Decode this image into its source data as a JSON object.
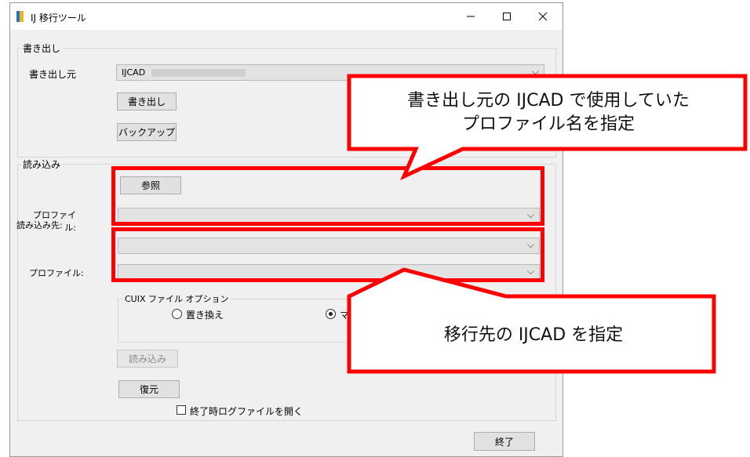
{
  "window": {
    "title": "IJ 移行ツール",
    "minimize": "—",
    "maximize": "☐",
    "close": "✕"
  },
  "export_group": {
    "label": "書き出し",
    "source_label": "書き出し元",
    "source_value": "IJCAD",
    "export_button": "書き出し",
    "backup_button": "バックアップ"
  },
  "import_group": {
    "label": "読み込み",
    "browse_button": "参照",
    "profile_label": "プロファイル:",
    "dest_label": "読み込み先:",
    "dest_profile_label": "プロファイル:",
    "cuix_label": "CUIX ファイル オプション",
    "radio_replace": "置き換え",
    "radio_merge": "マ",
    "import_button": "読み込み",
    "restore_button": "復元"
  },
  "log_checkbox_label": "終了時ログファイルを開く",
  "exit_button": "終了",
  "callouts": {
    "top": [
      "書き出し元の IJCAD で使用していた",
      "プロファイル名を指定"
    ],
    "bottom": "移行先の IJCAD を指定"
  },
  "colors": {
    "annotation": "#ff0000",
    "window_bg": "#f0f0f0",
    "accent_icon": "#1e73d2"
  }
}
